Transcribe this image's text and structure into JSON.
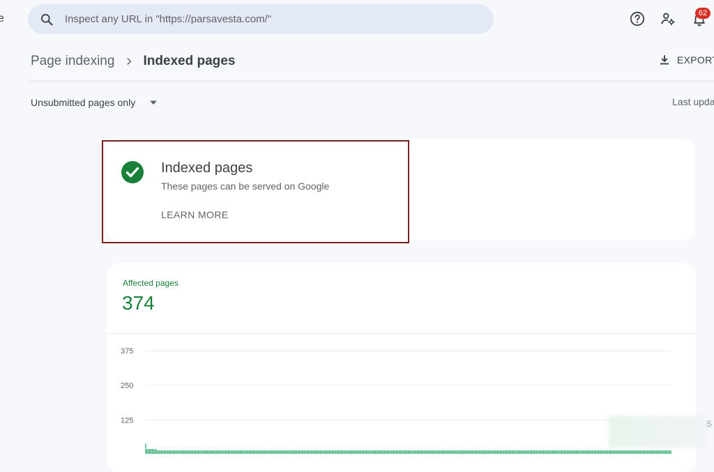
{
  "search": {
    "placeholder": "Inspect any URL in \"https://parsavesta.com/\""
  },
  "topbar": {
    "notification_count": "62"
  },
  "breadcrumb": {
    "parent": "Page indexing",
    "current": "Indexed pages"
  },
  "toolbar": {
    "export_label": "EXPORT",
    "last_updated_label": "Last upda"
  },
  "filter": {
    "selected": "Unsubmitted pages only"
  },
  "info_card": {
    "title": "Indexed pages",
    "subtitle": "These pages can be served on Google",
    "learn_more": "LEARN MORE"
  },
  "stats": {
    "label": "Affected pages",
    "value": "374"
  },
  "colors": {
    "accent_green": "#188038",
    "bar_green": "#0f9d58",
    "highlight": "#7b2121",
    "alert_red": "#d93025"
  },
  "chart_data": {
    "type": "bar",
    "y_ticks": [
      "375",
      "250",
      "125"
    ],
    "ylim": [
      0,
      375
    ],
    "values": [
      40,
      20,
      20,
      20,
      20,
      20,
      20,
      20,
      20,
      15,
      15,
      15,
      15,
      15,
      15,
      15,
      15,
      15,
      15,
      15,
      15,
      15,
      15,
      15,
      15,
      15,
      15,
      15,
      15,
      15,
      15,
      15,
      15,
      15,
      15,
      15,
      15,
      15,
      15,
      15,
      15,
      15,
      15,
      15,
      15,
      15,
      15,
      15,
      15,
      15,
      15,
      15,
      15,
      15,
      15,
      15,
      15,
      15,
      15,
      15,
      15,
      15,
      15,
      15,
      15,
      15,
      15,
      15,
      15,
      15,
      15,
      15,
      15,
      15,
      15,
      15,
      15,
      15,
      15,
      15,
      15,
      15,
      15,
      15,
      15,
      15,
      15,
      15,
      15,
      15,
      15,
      15,
      15,
      15,
      15,
      15,
      15,
      15,
      15,
      15,
      15,
      15,
      15,
      15,
      15,
      15,
      15,
      15,
      15,
      15,
      15,
      15,
      15,
      15,
      15,
      15,
      15,
      15,
      15,
      15,
      15,
      15,
      15,
      15,
      15,
      15,
      15,
      15,
      15,
      15,
      15,
      15,
      15,
      15,
      15,
      15,
      15,
      15,
      15,
      15,
      15,
      15,
      15,
      15,
      15,
      15,
      15,
      15,
      15,
      15,
      15,
      15,
      15,
      15,
      15,
      15,
      15,
      15,
      15,
      15,
      15,
      15,
      15,
      15,
      15,
      15,
      15,
      15,
      15,
      15,
      15,
      15,
      15,
      15,
      15,
      15,
      15,
      15,
      15,
      15,
      15,
      15,
      15,
      15,
      15,
      15,
      15,
      15,
      15,
      15,
      15,
      15,
      15,
      15,
      15,
      15,
      15,
      15,
      15,
      15,
      15,
      15,
      15,
      15,
      15,
      15,
      15,
      15,
      15,
      15,
      15,
      15,
      15,
      15,
      15,
      15,
      15,
      15,
      15,
      15,
      15,
      15,
      15,
      15,
      15,
      15,
      15,
      15,
      15,
      15,
      15,
      15,
      15,
      15,
      15,
      15,
      15,
      15,
      15,
      15,
      15,
      15,
      15,
      15,
      15,
      15,
      15,
      15,
      15,
      15,
      15,
      15,
      15,
      15,
      15,
      15,
      15,
      15,
      15,
      15,
      15,
      15,
      15,
      15,
      15,
      15,
      15,
      15,
      15,
      15,
      15,
      15,
      15,
      15,
      15,
      15,
      15,
      15,
      15,
      15,
      15,
      15,
      15,
      15,
      15,
      15,
      15,
      15,
      15,
      15,
      15,
      15,
      15,
      15,
      15,
      15,
      15,
      15,
      15,
      15,
      15,
      15,
      15,
      15,
      15,
      15,
      15,
      15,
      15,
      15,
      15,
      15,
      15,
      15,
      15,
      15,
      15,
      15,
      15,
      15,
      15,
      15,
      15,
      15,
      15,
      15,
      15,
      15,
      15,
      15,
      15,
      15,
      15,
      15,
      15,
      15,
      15,
      15,
      15,
      15,
      15,
      15,
      15,
      15,
      15,
      15,
      15,
      15,
      15,
      15,
      15,
      15,
      15,
      15,
      15,
      15,
      15,
      15,
      15,
      15,
      15,
      15,
      15,
      15,
      15,
      15,
      15,
      15,
      15,
      15,
      15,
      15,
      15,
      15,
      15,
      15,
      15,
      15,
      15,
      15,
      15,
      15,
      15,
      15,
      15,
      15,
      15,
      15,
      15,
      15,
      15,
      15,
      15,
      15,
      15,
      15,
      15,
      15,
      15,
      15,
      15
    ]
  }
}
